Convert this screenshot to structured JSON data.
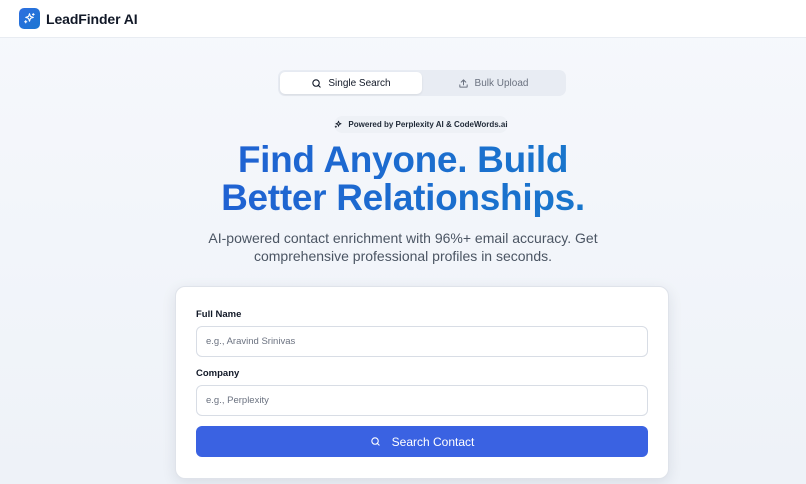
{
  "header": {
    "brand": "LeadFinder AI",
    "logo_icon": "sparkle-icon",
    "accent": "#2f6fe0"
  },
  "tabs": [
    {
      "label": "Single Search",
      "icon": "search-icon",
      "active": true
    },
    {
      "label": "Bulk Upload",
      "icon": "upload-icon",
      "active": false
    }
  ],
  "badge": {
    "text": "Powered by Perplexity AI & CodeWords.ai",
    "icon": "sparkle-icon"
  },
  "hero": {
    "line1": "Find Anyone. Build",
    "line2": "Better Relationships.",
    "subtitle_line1": "AI-powered contact enrichment with 96%+ email accuracy. Get",
    "subtitle_line2": "comprehensive professional profiles in seconds."
  },
  "form": {
    "full_name_label": "Full Name",
    "full_name_placeholder": "e.g., Aravind Srinivas",
    "full_name_value": "",
    "company_label": "Company",
    "company_placeholder": "e.g., Perplexity",
    "company_value": "",
    "submit_label": "Search Contact",
    "submit_color": "#3a62e2"
  }
}
